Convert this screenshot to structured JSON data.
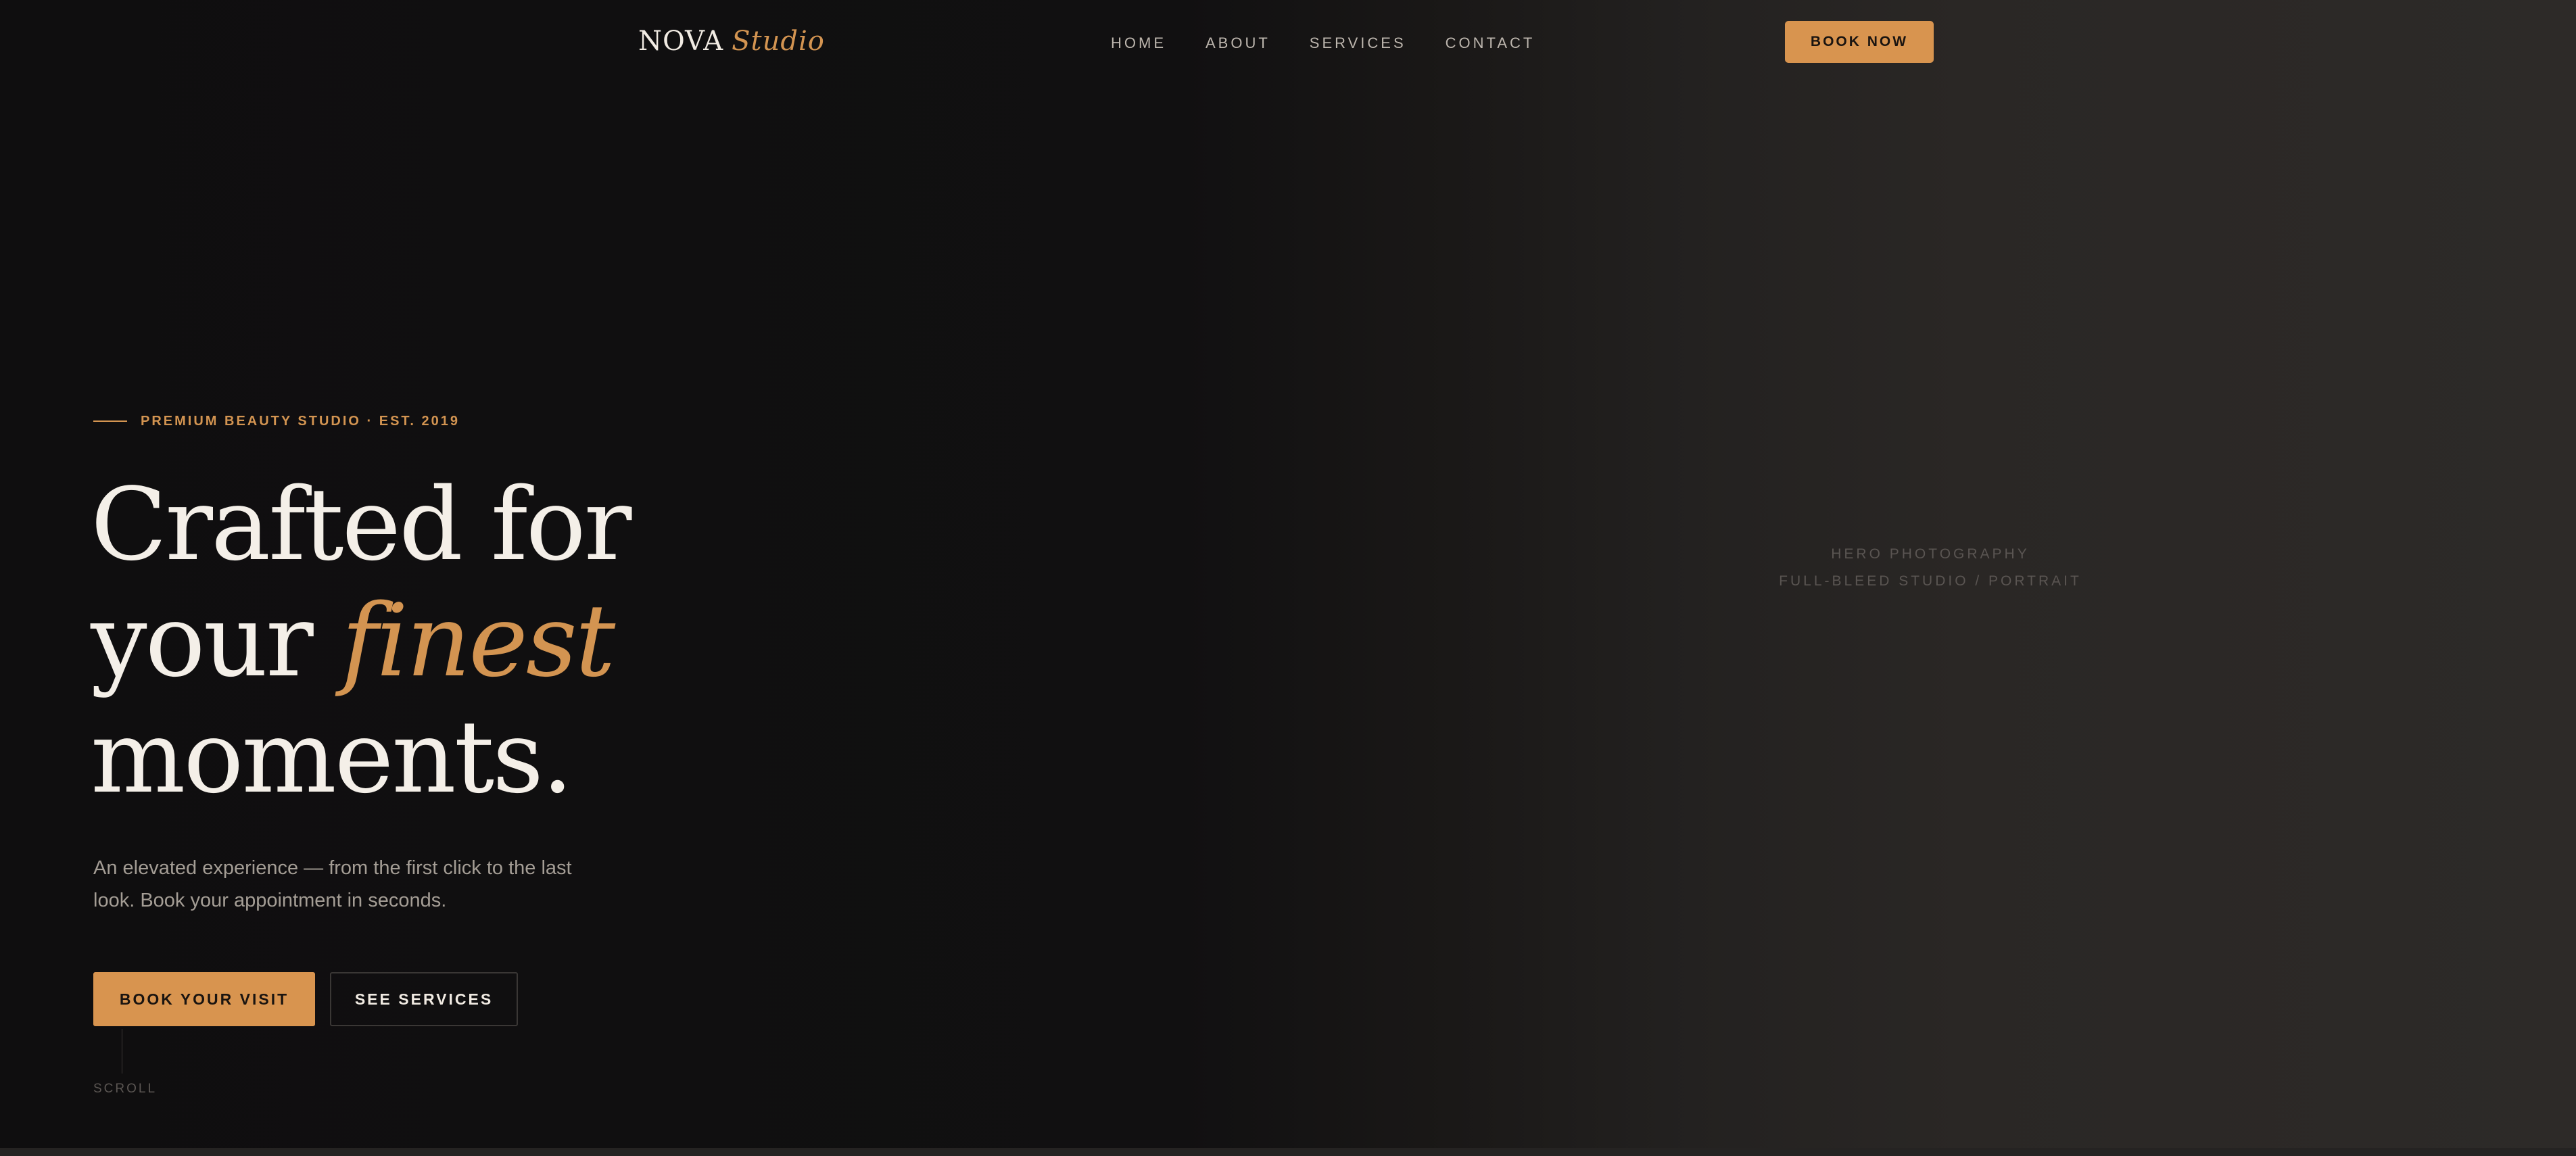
{
  "nav": {
    "logo_main": "NOVA",
    "logo_accent": "Studio",
    "links": [
      "HOME",
      "ABOUT",
      "SERVICES",
      "CONTACT"
    ],
    "cta_label": "BOOK NOW"
  },
  "hero": {
    "eyebrow": "PREMIUM BEAUTY STUDIO · EST. 2019",
    "headline_line1": "Crafted for",
    "headline_line2_start": "your",
    "headline_line2_accent": "finest",
    "headline_line3": "moments.",
    "subtext": "An elevated experience — from the first click to the last look. Book your appointment in seconds.",
    "primary_button": "BOOK YOUR VISIT",
    "secondary_button": "SEE SERVICES",
    "scroll_label": "SCROLL"
  },
  "hero_image": {
    "line1": "HERO PHOTOGRAPHY",
    "line2": "FULL-BLEED STUDIO / PORTRAIT"
  },
  "colors": {
    "background": "#0f0e0f",
    "accent": "#d8944f",
    "text_primary": "#f4efe8",
    "text_muted": "#a49d95"
  }
}
